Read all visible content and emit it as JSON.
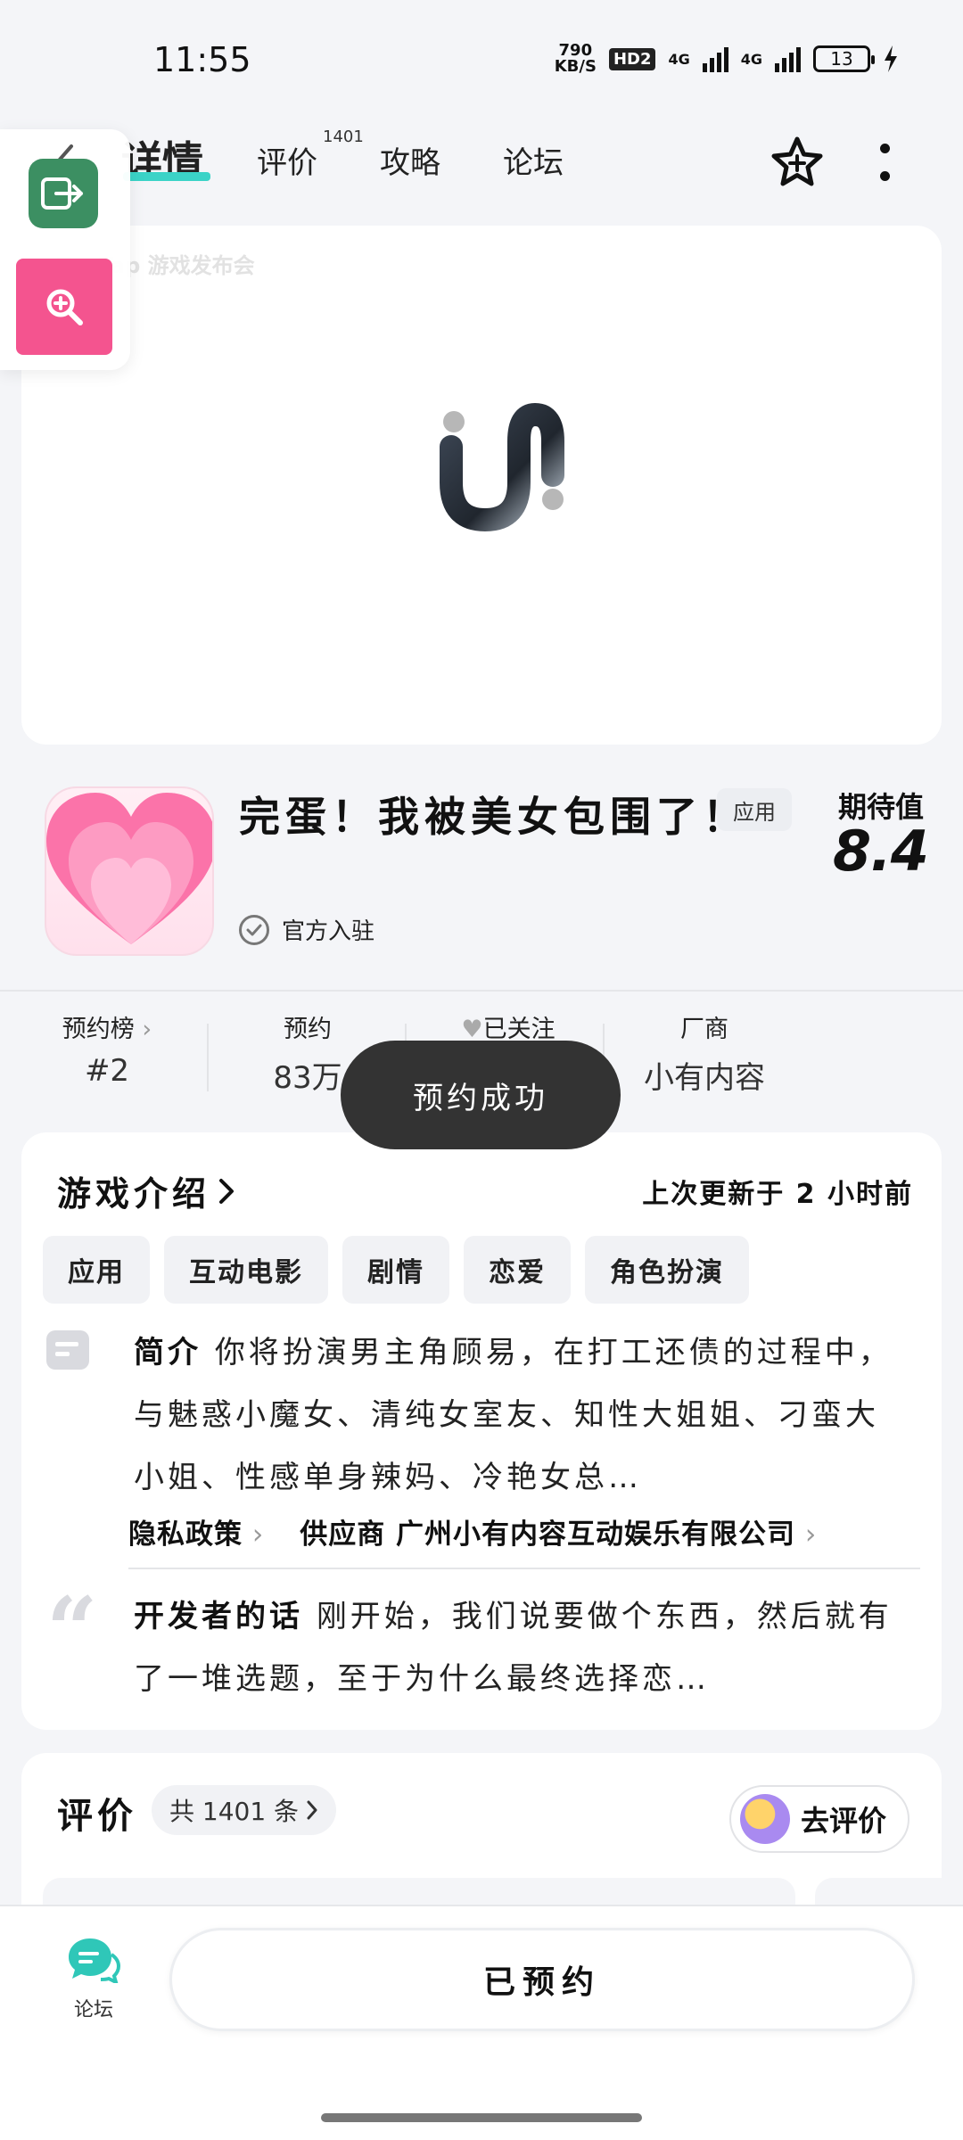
{
  "status_bar": {
    "time": "11:55",
    "net_speed_value": "790",
    "net_speed_unit": "KB/S",
    "hd_badge": "HD2",
    "net_type_1": "4G",
    "net_type_2": "4G",
    "battery": "13"
  },
  "header": {
    "tabs": [
      {
        "label": "详情"
      },
      {
        "label": "评价"
      },
      {
        "label": "攻略"
      },
      {
        "label": "论坛"
      }
    ],
    "review_count_sup": "1401"
  },
  "media": {
    "watermark": "TapTap 游戏发布会"
  },
  "game": {
    "title": "完蛋！我被美女包围了！",
    "type_tag": "应用",
    "expect_label": "期待值",
    "expect_value": "8.4",
    "verified_text": "官方入驻"
  },
  "stats": [
    {
      "label": "预约榜",
      "value": "#2"
    },
    {
      "label": "预约",
      "value": "83万"
    },
    {
      "label": "已关注",
      "value": ""
    },
    {
      "label": "厂商",
      "value": "小有内容"
    }
  ],
  "toast": "预约成功",
  "intro": {
    "title": "游戏介绍",
    "updated": "上次更新于 2 小时前",
    "tags": [
      "应用",
      "互动电影",
      "剧情",
      "恋爱",
      "角色扮演"
    ],
    "summary_label": "简介",
    "summary_text": "你将扮演男主角顾易，在打工还债的过程中，与魅惑小魔女、清纯女室友、知性大姐姐、刁蛮大小姐、性感单身辣妈、冷艳女总…",
    "privacy_label": "隐私政策",
    "supplier_label": "供应商 广州小有内容互动娱乐有限公司",
    "dev_label": "开发者的话",
    "dev_text": "刚开始，我们说要做个东西，然后就有了一堆选题，至于为什么最终选择恋…"
  },
  "reviews": {
    "title": "评价",
    "count_text": "共 1401 条",
    "go_review_label": "去评价"
  },
  "bottom": {
    "forum_label": "论坛",
    "reserved_label": "已预约"
  },
  "colors": {
    "accent_teal": "#3bd3c7",
    "toast_bg": "#333333",
    "float_green": "#3c8f62",
    "float_pink": "#f4548f",
    "forum_icon": "#2fc7b8"
  },
  "icons": {
    "back": "chevron-left-icon",
    "star": "star-icon",
    "more": "more-vertical-icon",
    "verified": "check-circle-icon",
    "heart": "heart-icon",
    "quote": "quote-icon",
    "forum": "chat-bubble-icon"
  }
}
